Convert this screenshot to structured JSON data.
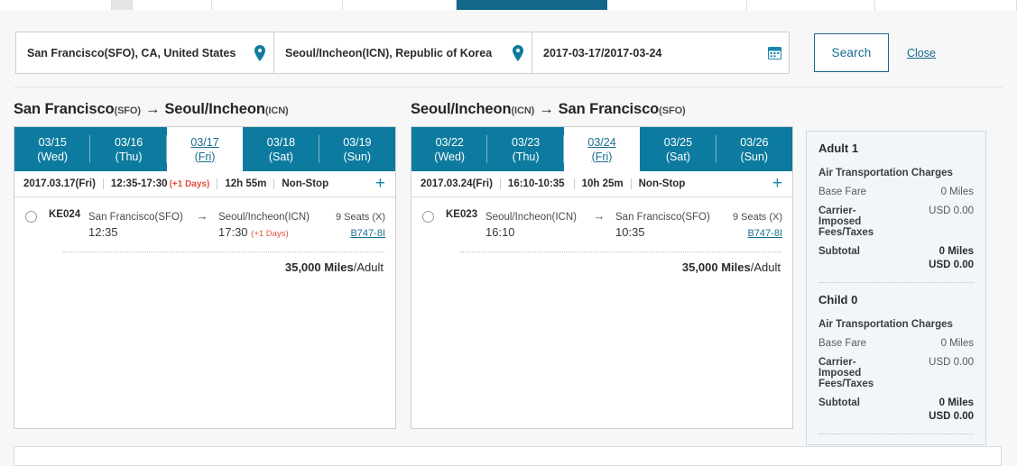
{
  "tabbar": {
    "tabs": [
      "",
      "",
      "",
      "",
      "",
      "",
      "",
      ""
    ]
  },
  "search": {
    "origin_value": "San Francisco(SFO), CA, United States",
    "destination_value": "Seoul/Incheon(ICN), Republic of Korea",
    "date_value": "2017-03-17/2017-03-24",
    "origin_icon": "map-pin-icon",
    "destination_icon": "map-pin-icon",
    "date_icon": "calendar-icon",
    "search_label": "Search",
    "close_label": "Close"
  },
  "trips": [
    {
      "from_city": "San Francisco",
      "from_code": "(SFO)",
      "arrow": "→",
      "to_city": "Seoul/Incheon",
      "to_code": "(ICN)",
      "date_tabs": [
        {
          "date": "03/15",
          "day": "(Wed)",
          "selected": false
        },
        {
          "date": "03/16",
          "day": "(Thu)",
          "selected": false
        },
        {
          "date": "03/17",
          "day": "(Fri)",
          "selected": true
        },
        {
          "date": "03/18",
          "day": "(Sat)",
          "selected": false
        },
        {
          "date": "03/19",
          "day": "(Sun)",
          "selected": false
        }
      ],
      "summary": {
        "date": "2017.03.17(Fri)",
        "times": "12:35-17:30",
        "plus_days": "(+1 Days)",
        "duration": "12h 55m",
        "stops": "Non-Stop",
        "expand_icon": "plus-icon"
      },
      "flight": {
        "number": "KE024",
        "dep_city": "San Francisco(SFO)",
        "dep_time": "12:35",
        "dep_plus": "",
        "arr_city": "Seoul/Incheon(ICN)",
        "arr_time": "17:30",
        "arr_plus": "(+1 Days)",
        "seats": "9 Seats (X)",
        "aircraft": "B747-8I"
      },
      "miles_value": "35,000 Miles",
      "miles_unit": "/Adult"
    },
    {
      "from_city": "Seoul/Incheon",
      "from_code": "(ICN)",
      "arrow": "→",
      "to_city": "San Francisco",
      "to_code": "(SFO)",
      "date_tabs": [
        {
          "date": "03/22",
          "day": "(Wed)",
          "selected": false
        },
        {
          "date": "03/23",
          "day": "(Thu)",
          "selected": false
        },
        {
          "date": "03/24",
          "day": "(Fri)",
          "selected": true
        },
        {
          "date": "03/25",
          "day": "(Sat)",
          "selected": false
        },
        {
          "date": "03/26",
          "day": "(Sun)",
          "selected": false
        }
      ],
      "summary": {
        "date": "2017.03.24(Fri)",
        "times": "16:10-10:35",
        "plus_days": "",
        "duration": "10h 25m",
        "stops": "Non-Stop",
        "expand_icon": "plus-icon"
      },
      "flight": {
        "number": "KE023",
        "dep_city": "Seoul/Incheon(ICN)",
        "dep_time": "16:10",
        "dep_plus": "",
        "arr_city": "San Francisco(SFO)",
        "arr_time": "10:35",
        "arr_plus": "",
        "seats": "9 Seats (X)",
        "aircraft": "B747-8I"
      },
      "miles_value": "35,000 Miles",
      "miles_unit": "/Adult"
    }
  ],
  "fare": {
    "groups": [
      {
        "title": "Adult 1",
        "section": "Air Transportation Charges",
        "base_label": "Base Fare",
        "base_amount": "0 Miles",
        "carrier_label": "Carrier-Imposed Fees/Taxes",
        "carrier_amount": "USD 0.00",
        "subtotal_label": "Subtotal",
        "subtotal_miles": "0 Miles",
        "subtotal_usd": "USD 0.00"
      },
      {
        "title": "Child 0",
        "section": "Air Transportation Charges",
        "base_label": "Base Fare",
        "base_amount": "0 Miles",
        "carrier_label": "Carrier-Imposed Fees/Taxes",
        "carrier_amount": "USD 0.00",
        "subtotal_label": "Subtotal",
        "subtotal_miles": "0 Miles",
        "subtotal_usd": "USD 0.00"
      }
    ]
  },
  "colors": {
    "teal": "#0d7b9f",
    "tab_active": "#15678a",
    "link": "#156a8e",
    "accent_red": "#e0533a",
    "fare_bg": "#f1f6fa"
  }
}
